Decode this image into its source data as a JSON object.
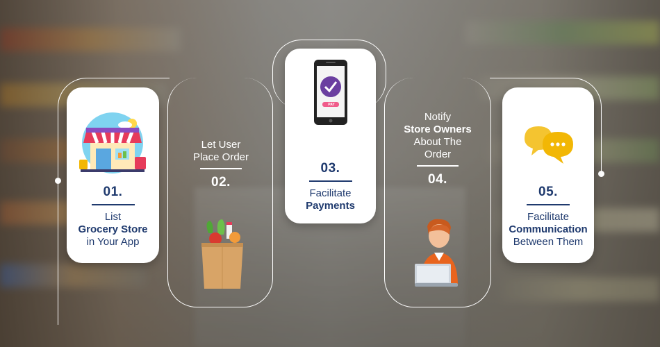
{
  "steps": [
    {
      "number": "01.",
      "line1": "List",
      "line2": "Grocery Store",
      "line3": "in Your App",
      "icon": "grocery-store-icon"
    },
    {
      "number": "02.",
      "line1": "Let User",
      "line2": "Place Order",
      "icon": "grocery-bag-icon"
    },
    {
      "number": "03.",
      "line1": "Facilitate",
      "line2": "Payments",
      "icon": "mobile-payment-icon",
      "icon_label": "PAY"
    },
    {
      "number": "04.",
      "line1": "Notify",
      "line2": "Store Owners",
      "line3": "About The",
      "line4": "Order",
      "icon": "store-owner-laptop-icon"
    },
    {
      "number": "05.",
      "line1": "Facilitate",
      "line2": "Communication",
      "line3": "Between Them",
      "icon": "chat-bubbles-icon"
    }
  ],
  "colors": {
    "navy": "#1f3a6e",
    "card": "#ffffff",
    "accent_purple": "#6b3fa0",
    "accent_orange": "#e8641e",
    "accent_yellow": "#f2b705"
  }
}
